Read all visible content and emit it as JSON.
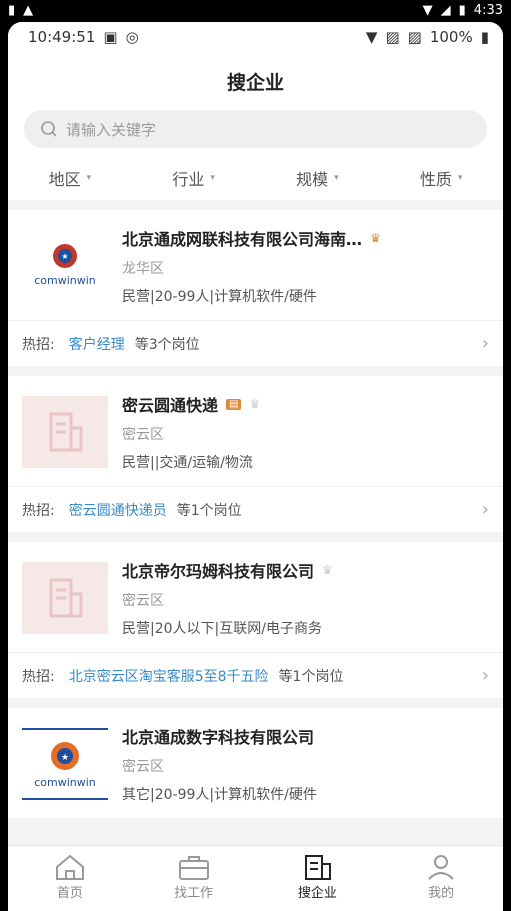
{
  "outer_status": {
    "time": "4:33"
  },
  "inner_status": {
    "time": "10:49:51",
    "battery": "100%"
  },
  "header": {
    "title": "搜企业"
  },
  "search": {
    "placeholder": "请输入关键字"
  },
  "filters": [
    {
      "label": "地区"
    },
    {
      "label": "行业"
    },
    {
      "label": "规模"
    },
    {
      "label": "性质"
    }
  ],
  "hot_label": "热招:",
  "companies": [
    {
      "name": "北京通成网联科技有限公司海南…",
      "district": "龙华区",
      "tags": "民营|20-99人|计算机软件/硬件",
      "logo_text": "comwinwin",
      "hot_job": "客户经理",
      "hot_count": "等3个岗位"
    },
    {
      "name": "密云圆通快递",
      "district": "密云区",
      "tags": "民营||交通/运输/物流",
      "hot_job": "密云圆通快递员",
      "hot_count": "等1个岗位"
    },
    {
      "name": "北京帝尔玛姆科技有限公司",
      "district": "密云区",
      "tags": "民营|20人以下|互联网/电子商务",
      "hot_job": "北京密云区淘宝客服5至8千五险",
      "hot_count": "等1个岗位"
    },
    {
      "name": "北京通成数字科技有限公司",
      "district": "密云区",
      "tags": "其它|20-99人|计算机软件/硬件",
      "logo_text": "comwinwin"
    }
  ],
  "tabs": [
    {
      "label": "首页"
    },
    {
      "label": "找工作"
    },
    {
      "label": "搜企业"
    },
    {
      "label": "我的"
    }
  ],
  "colors": {
    "accent": "#3a89c9",
    "crown": "#e0883a",
    "placeholder_logo": "#f7e8e8"
  }
}
